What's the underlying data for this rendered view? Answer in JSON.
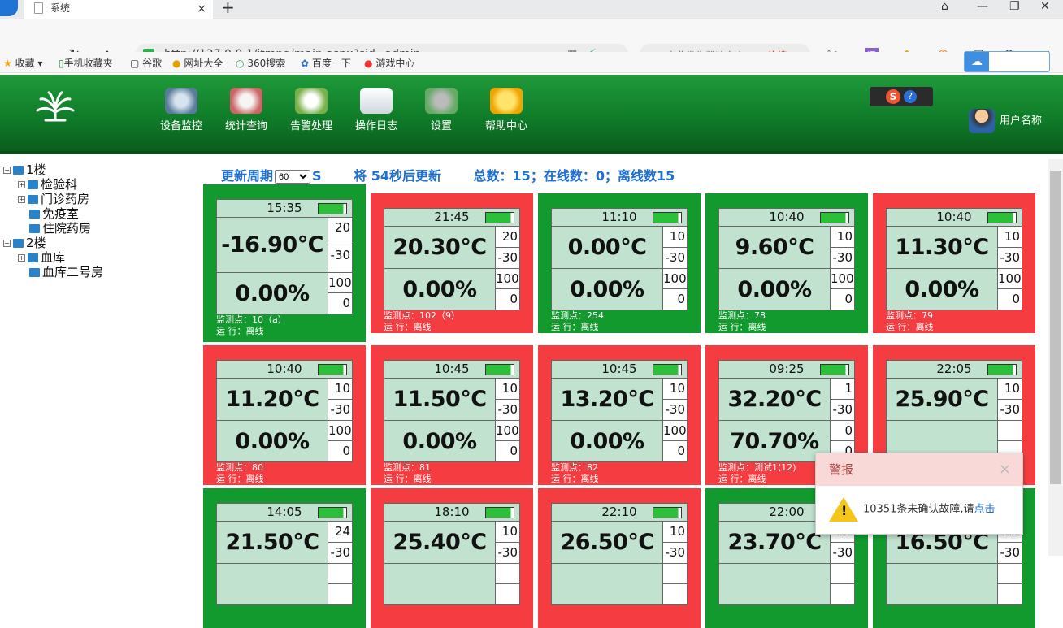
{
  "browser": {
    "tab_title": "系统",
    "url": "http://127.0.0.1/itmng/main.aspx?sid=admin",
    "search_text": "中非发生武装交火",
    "search_hot": "热搜",
    "bookmarks": [
      "收藏",
      "手机收藏夹",
      "谷歌",
      "网址大全",
      "360搜索",
      "百度一下",
      "游戏中心"
    ],
    "tool_translate": "译"
  },
  "header": {
    "menu": [
      "设备监控",
      "统计查询",
      "告警处理",
      "操作日志",
      "设置",
      "帮助中心"
    ],
    "user_name": "用户名称"
  },
  "tree": [
    {
      "label": "1楼",
      "toggle": "−"
    },
    {
      "label": "检验科",
      "toggle": "+"
    },
    {
      "label": "门诊药房",
      "toggle": "+"
    },
    {
      "label": "免疫室",
      "toggle": ""
    },
    {
      "label": "住院药房",
      "toggle": ""
    },
    {
      "label": "2楼",
      "toggle": "−"
    },
    {
      "label": "血库",
      "toggle": "+"
    },
    {
      "label": "血库二号房",
      "toggle": ""
    }
  ],
  "status": {
    "period_label": "更新周期",
    "period_value": "60",
    "period_unit": "S",
    "countdown": "将 54秒后更新",
    "summary": "总数：15；在线数：0；离线数15"
  },
  "cards": [
    {
      "status": "online",
      "time": "15:35",
      "temp": "-16.90℃",
      "t_hi": "20",
      "t_lo": "-30",
      "hum": "0.00%",
      "h_hi": "100",
      "h_lo": "0",
      "point": "监测点：10（a）",
      "run": "运  行：离线"
    },
    {
      "status": "offline",
      "time": "21:45",
      "temp": "20.30℃",
      "t_hi": "20",
      "t_lo": "-30",
      "hum": "0.00%",
      "h_hi": "100",
      "h_lo": "0",
      "point": "监测点：102（9）",
      "run": "运  行：离线"
    },
    {
      "status": "online",
      "time": "11:10",
      "temp": "0.00℃",
      "t_hi": "10",
      "t_lo": "-30",
      "hum": "0.00%",
      "h_hi": "100",
      "h_lo": "0",
      "point": "监测点：254",
      "run": "运  行：离线"
    },
    {
      "status": "online",
      "time": "10:40",
      "temp": "9.60℃",
      "t_hi": "10",
      "t_lo": "-30",
      "hum": "0.00%",
      "h_hi": "100",
      "h_lo": "0",
      "point": "监测点：78",
      "run": "运  行：离线"
    },
    {
      "status": "offline",
      "time": "10:40",
      "temp": "11.30℃",
      "t_hi": "10",
      "t_lo": "-30",
      "hum": "0.00%",
      "h_hi": "100",
      "h_lo": "0",
      "point": "监测点：79",
      "run": "运  行：离线"
    },
    {
      "status": "offline",
      "time": "10:40",
      "temp": "11.20℃",
      "t_hi": "10",
      "t_lo": "-30",
      "hum": "0.00%",
      "h_hi": "100",
      "h_lo": "0",
      "point": "监测点：80",
      "run": "运  行：离线"
    },
    {
      "status": "offline",
      "time": "10:45",
      "temp": "11.50℃",
      "t_hi": "10",
      "t_lo": "-30",
      "hum": "0.00%",
      "h_hi": "100",
      "h_lo": "0",
      "point": "监测点：81",
      "run": "运  行：离线"
    },
    {
      "status": "offline",
      "time": "10:45",
      "temp": "13.20℃",
      "t_hi": "10",
      "t_lo": "-30",
      "hum": "0.00%",
      "h_hi": "100",
      "h_lo": "0",
      "point": "监测点：82",
      "run": "运  行：离线"
    },
    {
      "status": "offline",
      "time": "09:25",
      "temp": "32.20℃",
      "t_hi": "1",
      "t_lo": "-30",
      "hum": "70.70%",
      "h_hi": "0",
      "h_lo": "0",
      "point": "监测点：测试1(12)",
      "run": "运  行：离线"
    },
    {
      "status": "offline",
      "time": "22:05",
      "temp": "25.90℃",
      "t_hi": "10",
      "t_lo": "-30",
      "hum": "",
      "h_hi": "",
      "h_lo": "",
      "point": "",
      "run": ""
    },
    {
      "status": "online",
      "time": "14:05",
      "temp": "21.50℃",
      "t_hi": "24",
      "t_lo": "-30",
      "hum": "",
      "h_hi": "",
      "h_lo": "",
      "point": "",
      "run": ""
    },
    {
      "status": "offline",
      "time": "18:10",
      "temp": "25.40℃",
      "t_hi": "10",
      "t_lo": "-30",
      "hum": "",
      "h_hi": "",
      "h_lo": "",
      "point": "",
      "run": ""
    },
    {
      "status": "offline",
      "time": "22:10",
      "temp": "26.50℃",
      "t_hi": "10",
      "t_lo": "-30",
      "hum": "",
      "h_hi": "",
      "h_lo": "",
      "point": "",
      "run": ""
    },
    {
      "status": "online",
      "time": "22:00",
      "temp": "23.70℃",
      "t_hi": "10",
      "t_lo": "-30",
      "hum": "",
      "h_hi": "",
      "h_lo": "",
      "point": "",
      "run": ""
    },
    {
      "status": "online",
      "time": "",
      "temp": "16.50℃",
      "t_hi": "10",
      "t_lo": "-30",
      "hum": "",
      "h_hi": "",
      "h_lo": "",
      "point": "",
      "run": ""
    }
  ],
  "alarm": {
    "title": "警报",
    "close": "×",
    "message": "10351条未确认故障,请",
    "link": "点击"
  }
}
